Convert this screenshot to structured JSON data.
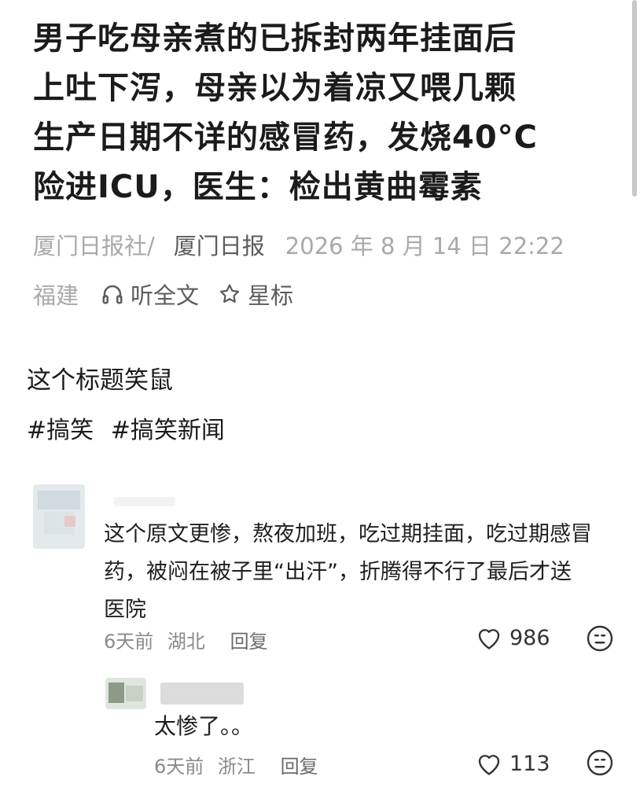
{
  "article": {
    "title_lines": [
      "男子吃母亲煮的已拆封两年挂面后",
      "上吐下泻，母亲以为着凉又喂几颗",
      "生产日期不详的感冒药，发烧40°C",
      "险进ICU，医生：检出黄曲霉素"
    ],
    "source": "厦门日报社/",
    "paper": "厦门日报",
    "date": "2026 年 8 月 14 日  22:22",
    "region": "福建",
    "listen_label": "听全文",
    "star_label": "星标"
  },
  "post": {
    "text": "这个标题笑鼠",
    "tags": [
      "#搞笑",
      "#搞笑新闻"
    ]
  },
  "comments": [
    {
      "text_lines": [
        "这个原文更惨，熬夜加班，吃过期挂面，吃过期感冒",
        "药，被闷在被子里“出汗”，折腾得不行了最后才送",
        "医院"
      ],
      "time": "6天前",
      "location": "湖北",
      "reply_label": "回复",
      "likes": "986"
    },
    {
      "text": "太惨了。。",
      "time": "6天前",
      "location": "浙江",
      "reply_label": "回复",
      "likes": "113"
    }
  ],
  "icons": {
    "headphones": "headphones-icon",
    "star": "star-icon",
    "heart": "heart-icon",
    "emoji": "sad-face-icon"
  }
}
